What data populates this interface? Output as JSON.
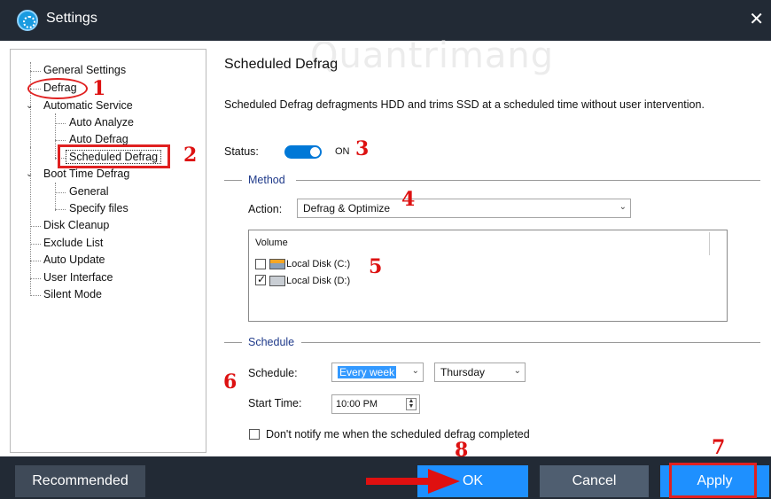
{
  "window": {
    "title": "Settings",
    "close": "✕"
  },
  "tree": {
    "items": [
      {
        "label": "General Settings"
      },
      {
        "label": "Defrag"
      },
      {
        "label": "Automatic Service"
      },
      {
        "label": "Auto Analyze"
      },
      {
        "label": "Auto Defrag"
      },
      {
        "label": "Scheduled Defrag"
      },
      {
        "label": "Boot Time Defrag"
      },
      {
        "label": "General"
      },
      {
        "label": "Specify files"
      },
      {
        "label": "Disk Cleanup"
      },
      {
        "label": "Exclude List"
      },
      {
        "label": "Auto Update"
      },
      {
        "label": "User Interface"
      },
      {
        "label": "Silent Mode"
      }
    ]
  },
  "main": {
    "title": "Scheduled Defrag",
    "watermark": "Quantrimang",
    "description": "Scheduled Defrag defragments HDD and trims SSD at a scheduled time without user intervention.",
    "status_label": "Status:",
    "status_value": "ON",
    "method_heading": "Method",
    "action_label": "Action:",
    "action_value": "Defrag & Optimize",
    "volume_header": "Volume",
    "volumes": [
      {
        "label": "Local Disk (C:)",
        "checked": false
      },
      {
        "label": "Local Disk (D:)",
        "checked": true
      }
    ],
    "schedule_heading": "Schedule",
    "schedule_label": "Schedule:",
    "schedule_value": "Every week",
    "day_value": "Thursday",
    "start_time_label": "Start Time:",
    "start_time_value": "10:00 PM",
    "notify_label": "Don't notify me when the scheduled defrag completed"
  },
  "footer": {
    "recommended": "Recommended",
    "ok": "OK",
    "cancel": "Cancel",
    "apply": "Apply"
  },
  "annotations": [
    "1",
    "2",
    "3",
    "4",
    "5",
    "6",
    "7",
    "8"
  ],
  "colors": {
    "titlebar": "#222a35",
    "accent": "#1e90ff",
    "annotation": "#d11111"
  }
}
